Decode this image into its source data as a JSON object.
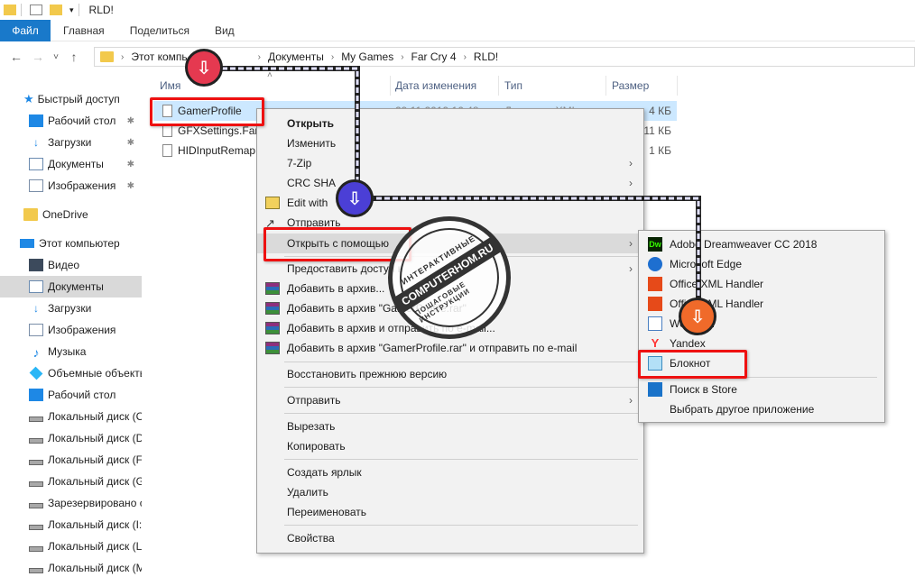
{
  "window": {
    "title": "RLD!"
  },
  "ribbon": {
    "tabs": [
      "Файл",
      "Главная",
      "Поделиться",
      "Вид"
    ]
  },
  "address": {
    "nav": {
      "back": "←",
      "forward": "→",
      "recent": "˅",
      "up": "↑"
    },
    "breadcrumbs": [
      "Этот компь",
      "Документы",
      "My Games",
      "Far Cry 4",
      "RLD!"
    ],
    "separator": "›"
  },
  "nav_pane": {
    "pin_glyph": "✱",
    "items": [
      {
        "label": "Быстрый доступ",
        "icon": "star-icon"
      },
      {
        "label": "Рабочий стол",
        "icon": "desktop-icon",
        "pinned": true
      },
      {
        "label": "Загрузки",
        "icon": "download-icon",
        "pinned": true
      },
      {
        "label": "Документы",
        "icon": "document-icon",
        "pinned": true
      },
      {
        "label": "Изображения",
        "icon": "picture-icon",
        "pinned": true
      },
      {
        "label": "OneDrive",
        "icon": "folder-icon"
      },
      {
        "label": "Этот компьютер",
        "icon": "computer-icon"
      },
      {
        "label": "Видео",
        "icon": "video-icon"
      },
      {
        "label": "Документы",
        "icon": "document-icon",
        "selected": true
      },
      {
        "label": "Загрузки",
        "icon": "download-icon"
      },
      {
        "label": "Изображения",
        "icon": "picture-icon"
      },
      {
        "label": "Музыка",
        "icon": "music-icon"
      },
      {
        "label": "Объемные объекты",
        "icon": "3d-objects-icon"
      },
      {
        "label": "Рабочий стол",
        "icon": "desktop-icon"
      },
      {
        "label": "Локальный диск (C",
        "icon": "drive-icon"
      },
      {
        "label": "Локальный диск (D",
        "icon": "drive-icon"
      },
      {
        "label": "Локальный диск (F",
        "icon": "drive-icon"
      },
      {
        "label": "Локальный диск (G",
        "icon": "drive-icon"
      },
      {
        "label": "Зарезервировано с",
        "icon": "drive-icon"
      },
      {
        "label": "Локальный диск (I:",
        "icon": "drive-icon"
      },
      {
        "label": "Локальный диск (L",
        "icon": "drive-icon"
      },
      {
        "label": "Локальный диск (M",
        "icon": "drive-icon"
      }
    ]
  },
  "columns": {
    "name": "Имя",
    "modified": "Дата изменения",
    "type": "Тип",
    "size": "Размер",
    "sort_glyph": "˄"
  },
  "files": [
    {
      "name": "GamerProfile",
      "modified": "29.11.2019 16:48",
      "type": "Документ XML",
      "size": "4 КБ",
      "selected": true
    },
    {
      "name": "GFXSettings.FarC",
      "modified": "",
      "type": "",
      "size": "11 КБ"
    },
    {
      "name": "HIDInputRemap",
      "modified": "",
      "type": "",
      "size": "1 КБ"
    }
  ],
  "context_menu": {
    "submenu_arrow": "›",
    "items": [
      {
        "label": "Открыть",
        "bold": true
      },
      {
        "label": "Изменить"
      },
      {
        "label": "7-Zip",
        "submenu": true
      },
      {
        "label": "CRC SHA",
        "submenu": true
      },
      {
        "label": "Edit with",
        "icon": "edit-icon"
      },
      {
        "label": "Отправить",
        "icon": "share-icon"
      },
      {
        "label": "Открыть с помощью",
        "submenu": true,
        "highlighted": true
      },
      {
        "label": "Предоставить доступ к",
        "submenu": true
      },
      {
        "label": "Добавить в архив...",
        "icon": "winrar-icon"
      },
      {
        "label": "Добавить в архив \"GamerProfile.rar\"",
        "icon": "winrar-icon"
      },
      {
        "label": "Добавить в архив и отправить по e-mail...",
        "icon": "winrar-icon"
      },
      {
        "label": "Добавить в архив \"GamerProfile.rar\" и отправить по e-mail",
        "icon": "winrar-icon"
      },
      {
        "label": "Восстановить прежнюю версию"
      },
      {
        "label": "Отправить",
        "submenu": true
      },
      {
        "label": "Вырезать"
      },
      {
        "label": "Копировать"
      },
      {
        "label": "Создать ярлык"
      },
      {
        "label": "Удалить"
      },
      {
        "label": "Переименовать"
      },
      {
        "label": "Свойства"
      }
    ]
  },
  "open_with_menu": {
    "items": [
      {
        "label": "Adobe Dreamweaver CC 2018",
        "icon": "dreamweaver-icon",
        "icon_text": "Dw"
      },
      {
        "label": "Microsoft Edge",
        "icon": "edge-icon"
      },
      {
        "label": "Office XML Handler",
        "icon": "office-icon"
      },
      {
        "label": "Office XML Handler",
        "icon": "office-icon"
      },
      {
        "label": "WordPad",
        "icon": "wordpad-icon"
      },
      {
        "label": "Yandex",
        "icon": "yandex-icon"
      },
      {
        "label": "Блокнот",
        "icon": "notepad-icon"
      },
      {
        "label": "Поиск в Store",
        "icon": "store-icon"
      },
      {
        "label": "Выбрать другое приложение"
      }
    ]
  },
  "annotations": {
    "step_glyph": "⇩"
  },
  "watermark": {
    "top": "ИНТЕРАКТИВНЫЕ",
    "center": "COMPUTERHOM.RU",
    "bottom": "ПОШАГОВЫЕ ИНСТРУКЦИИ"
  },
  "colors": {
    "accent": "#1979ca",
    "highlight_box": "#ee1111",
    "step1": "#e53950",
    "step2": "#4b3fd6",
    "step3": "#f06a2a",
    "selection": "#cce8ff"
  }
}
